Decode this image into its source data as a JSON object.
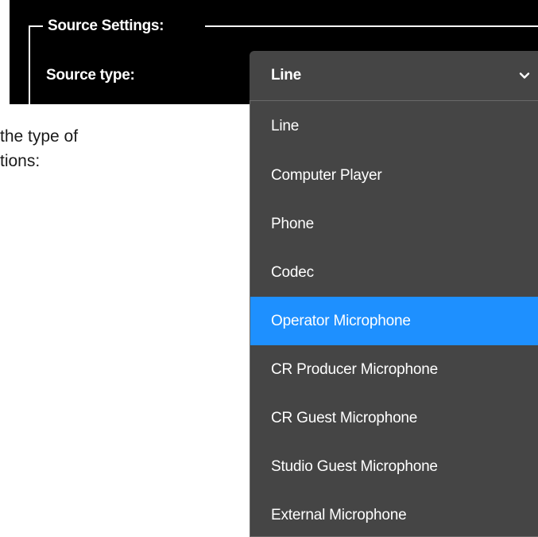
{
  "settings": {
    "legend": "Source Settings:",
    "source_type_label": "Source type:",
    "selected_value": "Line"
  },
  "body_text": {
    "line1": "the type of",
    "line2": "tions:"
  },
  "dropdown": {
    "options": [
      "Line",
      "Computer Player",
      "Phone",
      "Codec",
      "Operator Microphone",
      "CR Producer Microphone",
      "CR Guest Microphone",
      "Studio Guest Microphone",
      "External Microphone"
    ],
    "highlighted": "Operator Microphone"
  },
  "colors": {
    "panel_bg": "#000000",
    "dropdown_bg": "#454545",
    "highlight": "#1e90ff",
    "text": "#ffffff"
  },
  "icons": {
    "select_chevron": "chevron-down-icon"
  }
}
